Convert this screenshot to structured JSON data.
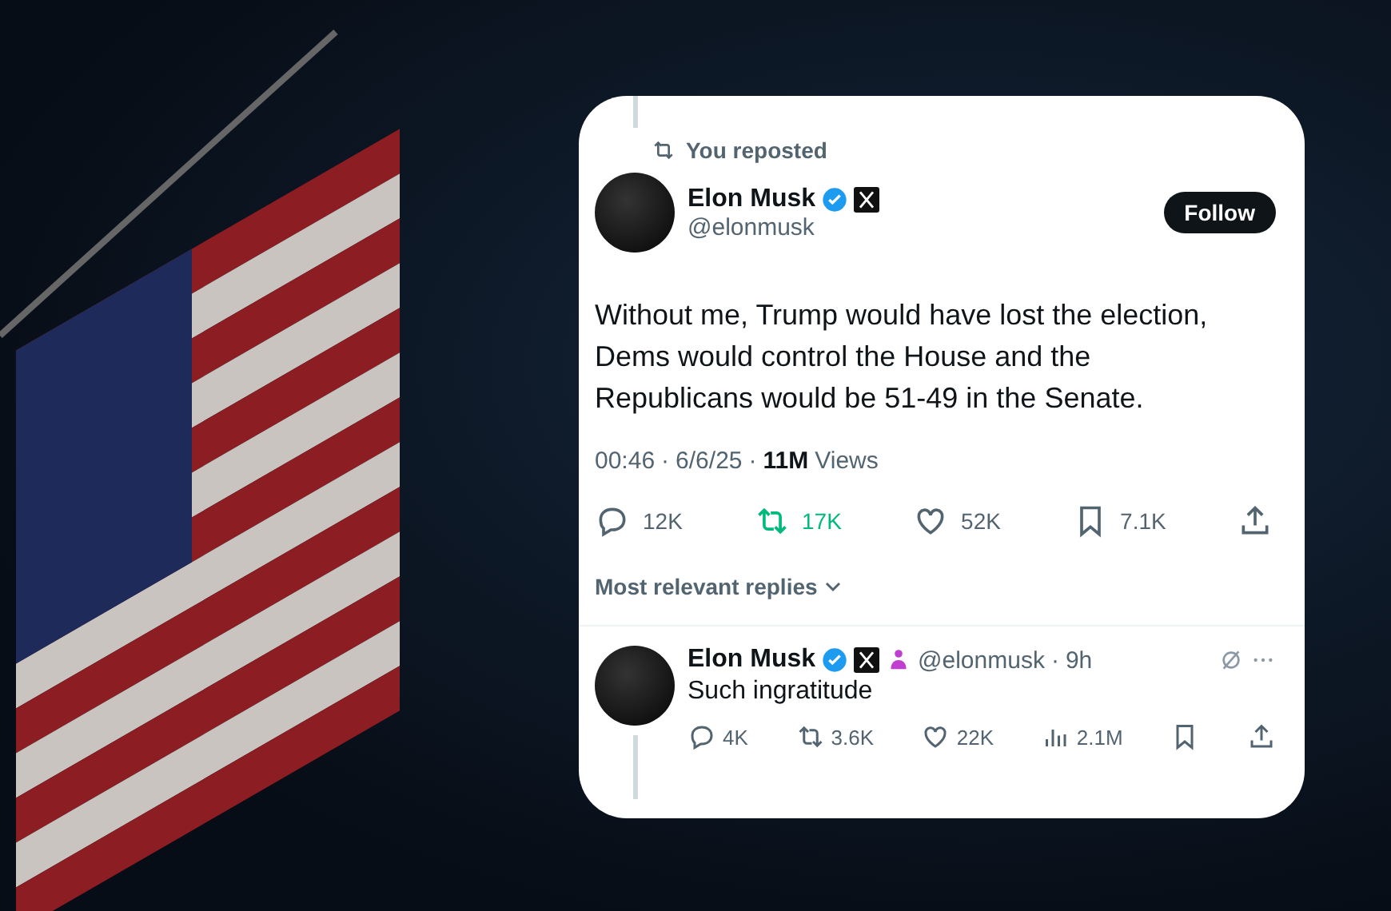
{
  "repost_banner": {
    "text": "You reposted"
  },
  "tweet": {
    "author": "Elon Musk",
    "verified": true,
    "handle": "@elonmusk",
    "follow_button": "Follow",
    "text": "Without me, Trump would have lost the election, Dems would control the House and the Republicans would be 51-49 in the Senate.",
    "separator": "·",
    "time": "00:46",
    "date": "6/6/25",
    "views_count": "11M",
    "views_label": "Views",
    "actions": [
      {
        "kind": "reply",
        "count": "12K",
        "active": false
      },
      {
        "kind": "repost",
        "count": "17K",
        "active": true
      },
      {
        "kind": "like",
        "count": "52K",
        "active": false
      },
      {
        "kind": "bookmark",
        "count": "7.1K",
        "active": false
      },
      {
        "kind": "share",
        "active": false
      }
    ]
  },
  "replies_sort": {
    "label": "Most relevant replies"
  },
  "reply": {
    "author": "Elon Musk",
    "verified": true,
    "handle": "@elonmusk",
    "separator": "·",
    "age": "9h",
    "text": "Such ingratitude",
    "actions": [
      {
        "kind": "reply",
        "count": "4K",
        "active": false
      },
      {
        "kind": "repost",
        "count": "3.6K",
        "active": false
      },
      {
        "kind": "like",
        "count": "22K",
        "active": false
      },
      {
        "kind": "views",
        "count": "2.1M",
        "active": false
      },
      {
        "kind": "bookmark",
        "active": false
      },
      {
        "kind": "share",
        "active": false
      }
    ]
  }
}
